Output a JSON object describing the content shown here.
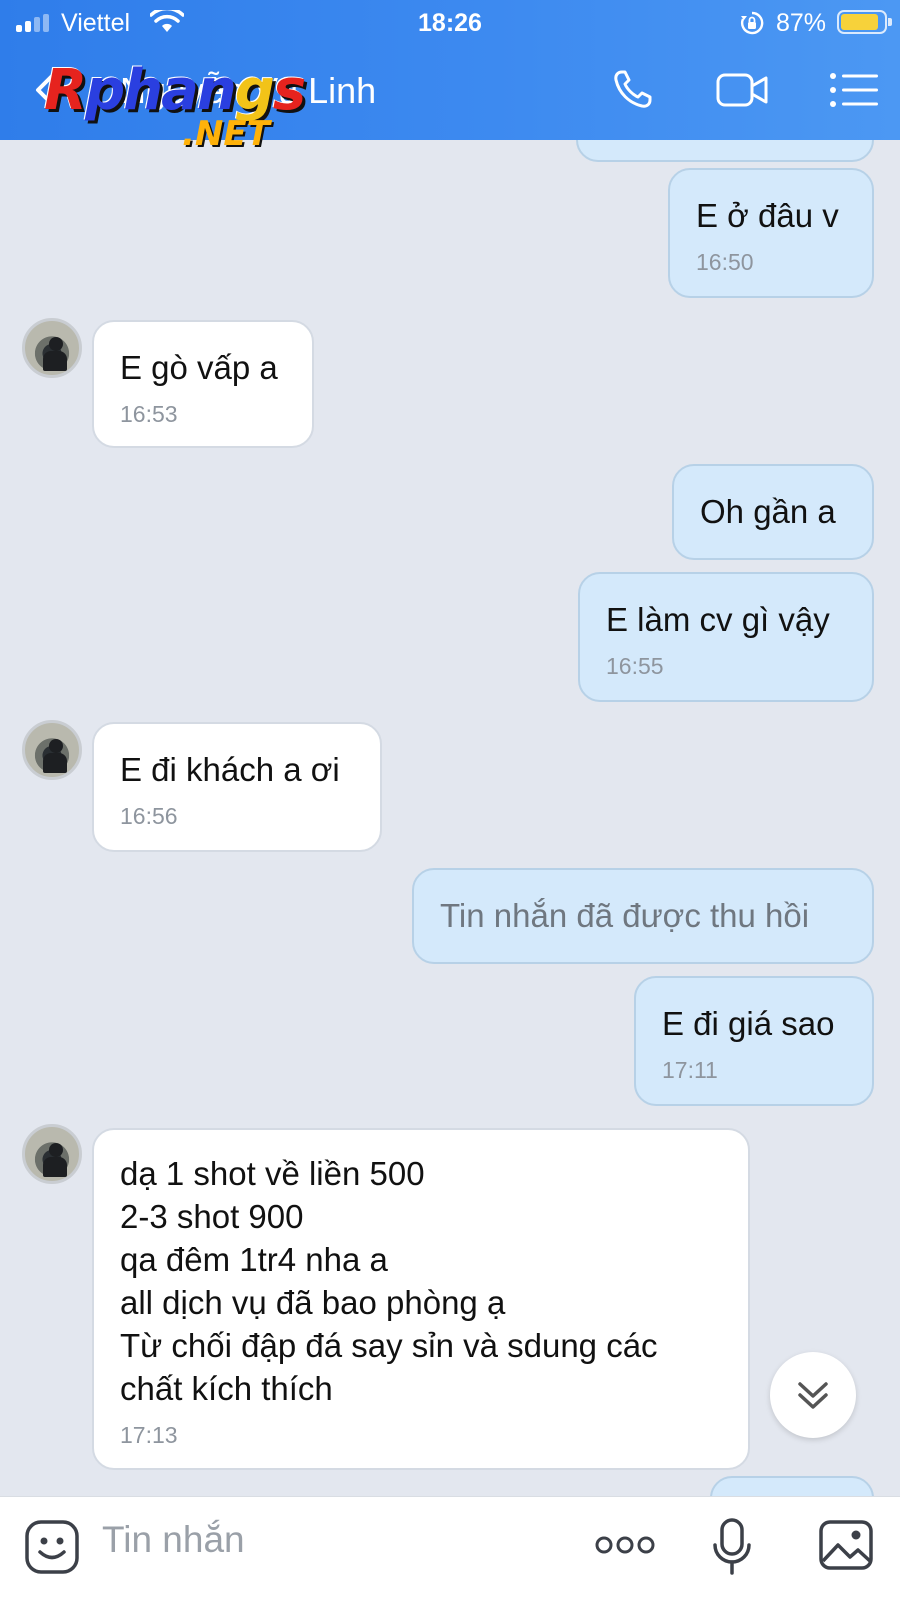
{
  "status_bar": {
    "carrier": "Viettel",
    "time": "18:26",
    "battery": "87%",
    "battery_level": 0.87
  },
  "header": {
    "contact_name": "Nguyễn Vũ Linh",
    "watermark": "Rphang.NET",
    "icons": [
      "back-icon",
      "phone-icon",
      "video-call-icon",
      "menu-list-icon"
    ]
  },
  "messages": [
    {
      "dir": "out",
      "text": "E ở đâu v",
      "time": "16:50"
    },
    {
      "dir": "in",
      "text": "E gò vấp a",
      "time": "16:53"
    },
    {
      "dir": "out",
      "text": "Oh gần a",
      "time": ""
    },
    {
      "dir": "out",
      "text": "E làm cv gì vậy",
      "time": "16:55"
    },
    {
      "dir": "in",
      "text": "E đi khách a ơi",
      "time": "16:56"
    },
    {
      "dir": "out",
      "text": "Tin nhắn đã được thu hồi",
      "time": "",
      "recalled": true
    },
    {
      "dir": "out",
      "text": "E đi giá sao",
      "time": "17:11"
    },
    {
      "dir": "in",
      "text": "dạ 1 shot về liền 500\n2-3 shot 900\nqa đêm 1tr4 nha a\nall dịch vụ đã bao phòng ạ\nTừ chối đập đá say sỉn và sdung các\nchất kích thích",
      "time": "17:13"
    }
  ],
  "input_bar": {
    "placeholder": "Tin nhắn",
    "icons": [
      "emoji-icon",
      "more-icon",
      "microphone-icon",
      "photo-icon"
    ]
  },
  "colors": {
    "header_gradient_start": "#2f7dea",
    "header_gradient_end": "#4c98f3",
    "chat_background": "#e3e7ef",
    "outgoing_bubble": "#d4e9fb",
    "incoming_bubble": "#ffffff",
    "battery_fill": "#f7d23a"
  }
}
